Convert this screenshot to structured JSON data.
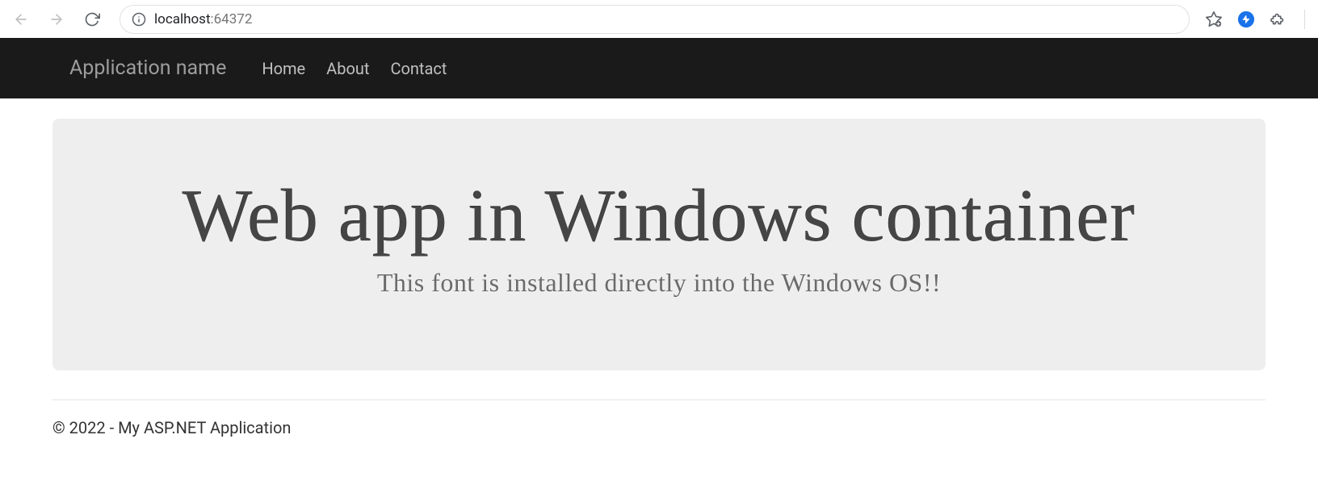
{
  "browser": {
    "url_host": "localhost",
    "url_port": ":64372"
  },
  "navbar": {
    "brand": "Application name",
    "links": [
      {
        "label": "Home"
      },
      {
        "label": "About"
      },
      {
        "label": "Contact"
      }
    ]
  },
  "hero": {
    "title": "Web app in Windows container",
    "subtitle": "This font is installed directly into the Windows OS!!"
  },
  "footer": {
    "text": "© 2022 - My ASP.NET Application"
  }
}
